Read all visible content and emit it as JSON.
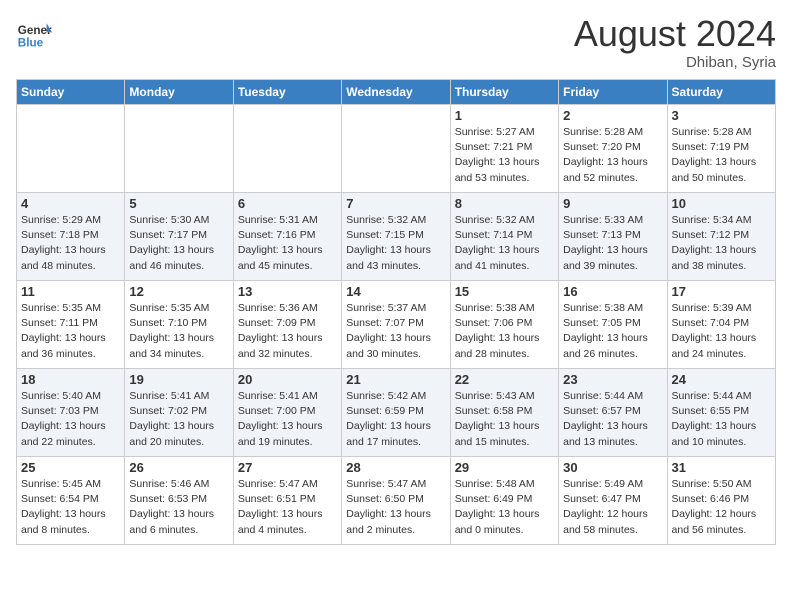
{
  "header": {
    "logo_line1": "General",
    "logo_line2": "Blue",
    "month_year": "August 2024",
    "location": "Dhiban, Syria"
  },
  "weekdays": [
    "Sunday",
    "Monday",
    "Tuesday",
    "Wednesday",
    "Thursday",
    "Friday",
    "Saturday"
  ],
  "weeks": [
    [
      {
        "day": "",
        "info": ""
      },
      {
        "day": "",
        "info": ""
      },
      {
        "day": "",
        "info": ""
      },
      {
        "day": "",
        "info": ""
      },
      {
        "day": "1",
        "info": "Sunrise: 5:27 AM\nSunset: 7:21 PM\nDaylight: 13 hours\nand 53 minutes."
      },
      {
        "day": "2",
        "info": "Sunrise: 5:28 AM\nSunset: 7:20 PM\nDaylight: 13 hours\nand 52 minutes."
      },
      {
        "day": "3",
        "info": "Sunrise: 5:28 AM\nSunset: 7:19 PM\nDaylight: 13 hours\nand 50 minutes."
      }
    ],
    [
      {
        "day": "4",
        "info": "Sunrise: 5:29 AM\nSunset: 7:18 PM\nDaylight: 13 hours\nand 48 minutes."
      },
      {
        "day": "5",
        "info": "Sunrise: 5:30 AM\nSunset: 7:17 PM\nDaylight: 13 hours\nand 46 minutes."
      },
      {
        "day": "6",
        "info": "Sunrise: 5:31 AM\nSunset: 7:16 PM\nDaylight: 13 hours\nand 45 minutes."
      },
      {
        "day": "7",
        "info": "Sunrise: 5:32 AM\nSunset: 7:15 PM\nDaylight: 13 hours\nand 43 minutes."
      },
      {
        "day": "8",
        "info": "Sunrise: 5:32 AM\nSunset: 7:14 PM\nDaylight: 13 hours\nand 41 minutes."
      },
      {
        "day": "9",
        "info": "Sunrise: 5:33 AM\nSunset: 7:13 PM\nDaylight: 13 hours\nand 39 minutes."
      },
      {
        "day": "10",
        "info": "Sunrise: 5:34 AM\nSunset: 7:12 PM\nDaylight: 13 hours\nand 38 minutes."
      }
    ],
    [
      {
        "day": "11",
        "info": "Sunrise: 5:35 AM\nSunset: 7:11 PM\nDaylight: 13 hours\nand 36 minutes."
      },
      {
        "day": "12",
        "info": "Sunrise: 5:35 AM\nSunset: 7:10 PM\nDaylight: 13 hours\nand 34 minutes."
      },
      {
        "day": "13",
        "info": "Sunrise: 5:36 AM\nSunset: 7:09 PM\nDaylight: 13 hours\nand 32 minutes."
      },
      {
        "day": "14",
        "info": "Sunrise: 5:37 AM\nSunset: 7:07 PM\nDaylight: 13 hours\nand 30 minutes."
      },
      {
        "day": "15",
        "info": "Sunrise: 5:38 AM\nSunset: 7:06 PM\nDaylight: 13 hours\nand 28 minutes."
      },
      {
        "day": "16",
        "info": "Sunrise: 5:38 AM\nSunset: 7:05 PM\nDaylight: 13 hours\nand 26 minutes."
      },
      {
        "day": "17",
        "info": "Sunrise: 5:39 AM\nSunset: 7:04 PM\nDaylight: 13 hours\nand 24 minutes."
      }
    ],
    [
      {
        "day": "18",
        "info": "Sunrise: 5:40 AM\nSunset: 7:03 PM\nDaylight: 13 hours\nand 22 minutes."
      },
      {
        "day": "19",
        "info": "Sunrise: 5:41 AM\nSunset: 7:02 PM\nDaylight: 13 hours\nand 20 minutes."
      },
      {
        "day": "20",
        "info": "Sunrise: 5:41 AM\nSunset: 7:00 PM\nDaylight: 13 hours\nand 19 minutes."
      },
      {
        "day": "21",
        "info": "Sunrise: 5:42 AM\nSunset: 6:59 PM\nDaylight: 13 hours\nand 17 minutes."
      },
      {
        "day": "22",
        "info": "Sunrise: 5:43 AM\nSunset: 6:58 PM\nDaylight: 13 hours\nand 15 minutes."
      },
      {
        "day": "23",
        "info": "Sunrise: 5:44 AM\nSunset: 6:57 PM\nDaylight: 13 hours\nand 13 minutes."
      },
      {
        "day": "24",
        "info": "Sunrise: 5:44 AM\nSunset: 6:55 PM\nDaylight: 13 hours\nand 10 minutes."
      }
    ],
    [
      {
        "day": "25",
        "info": "Sunrise: 5:45 AM\nSunset: 6:54 PM\nDaylight: 13 hours\nand 8 minutes."
      },
      {
        "day": "26",
        "info": "Sunrise: 5:46 AM\nSunset: 6:53 PM\nDaylight: 13 hours\nand 6 minutes."
      },
      {
        "day": "27",
        "info": "Sunrise: 5:47 AM\nSunset: 6:51 PM\nDaylight: 13 hours\nand 4 minutes."
      },
      {
        "day": "28",
        "info": "Sunrise: 5:47 AM\nSunset: 6:50 PM\nDaylight: 13 hours\nand 2 minutes."
      },
      {
        "day": "29",
        "info": "Sunrise: 5:48 AM\nSunset: 6:49 PM\nDaylight: 13 hours\nand 0 minutes."
      },
      {
        "day": "30",
        "info": "Sunrise: 5:49 AM\nSunset: 6:47 PM\nDaylight: 12 hours\nand 58 minutes."
      },
      {
        "day": "31",
        "info": "Sunrise: 5:50 AM\nSunset: 6:46 PM\nDaylight: 12 hours\nand 56 minutes."
      }
    ]
  ]
}
